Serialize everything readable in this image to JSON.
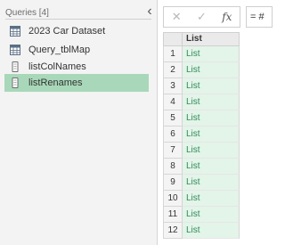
{
  "queries": {
    "header": "Queries [4]",
    "items": [
      {
        "label": "2023 Car Dataset",
        "icon": "table-icon",
        "selected": false
      },
      {
        "label": "Query_tblMap",
        "icon": "table-icon",
        "selected": false
      },
      {
        "label": "listColNames",
        "icon": "list-icon",
        "selected": false
      },
      {
        "label": "listRenames",
        "icon": "list-icon",
        "selected": true
      }
    ]
  },
  "formula_bar": {
    "cancel_glyph": "✕",
    "commit_glyph": "✓",
    "fx_label": "fx",
    "formula_text": "= #"
  },
  "grid": {
    "column_header": "List",
    "rows": [
      {
        "n": "1",
        "value": "List"
      },
      {
        "n": "2",
        "value": "List"
      },
      {
        "n": "3",
        "value": "List"
      },
      {
        "n": "4",
        "value": "List"
      },
      {
        "n": "5",
        "value": "List"
      },
      {
        "n": "6",
        "value": "List"
      },
      {
        "n": "7",
        "value": "List"
      },
      {
        "n": "8",
        "value": "List"
      },
      {
        "n": "9",
        "value": "List"
      },
      {
        "n": "10",
        "value": "List"
      },
      {
        "n": "11",
        "value": "List"
      },
      {
        "n": "12",
        "value": "List"
      }
    ]
  },
  "colors": {
    "selected_item": "#a8d8b9",
    "list_text": "#2e8b57",
    "cell_bg": "#e3f4e9"
  }
}
